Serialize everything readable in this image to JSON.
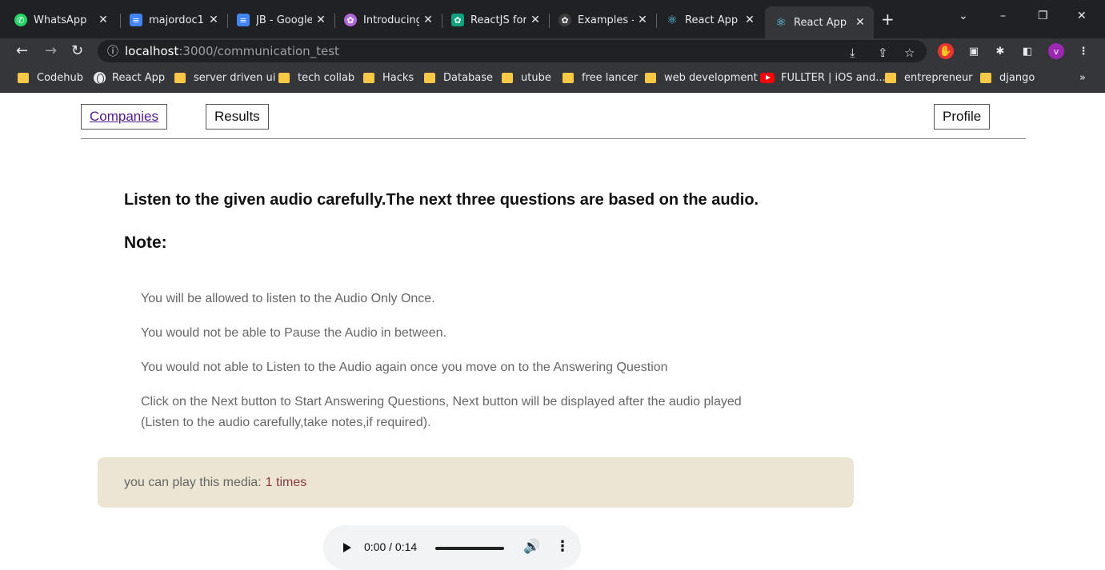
{
  "browser": {
    "tabs": [
      {
        "title": "WhatsApp",
        "icon": "whatsapp-icon",
        "color": "#25d366"
      },
      {
        "title": "majordoc1 -",
        "icon": "google-docs-icon",
        "color": "#4285f4"
      },
      {
        "title": "JB - Google",
        "icon": "google-docs-icon",
        "color": "#4285f4"
      },
      {
        "title": "Introducing",
        "icon": "openai-icon",
        "color": "#b368d9"
      },
      {
        "title": "ReactJS for",
        "icon": "chatgpt-icon",
        "color": "#10a37f"
      },
      {
        "title": "Examples -",
        "icon": "openai-icon",
        "color": "#3c3c3c"
      },
      {
        "title": "React App",
        "icon": "react-icon",
        "color": "#61dafb"
      },
      {
        "title": "React App",
        "icon": "react-icon",
        "color": "#61dafb",
        "active": true
      }
    ],
    "address": {
      "host": "localhost",
      "path": ":3000/communication_test"
    },
    "bookmarks": [
      {
        "label": "Codehub",
        "icon": "folder-icon"
      },
      {
        "label": "React App",
        "icon": "globe-icon"
      },
      {
        "label": "server driven ui",
        "icon": "folder-icon"
      },
      {
        "label": "tech collab",
        "icon": "folder-icon"
      },
      {
        "label": "Hacks",
        "icon": "folder-icon"
      },
      {
        "label": "Database",
        "icon": "folder-icon"
      },
      {
        "label": "utube",
        "icon": "folder-icon"
      },
      {
        "label": "free lancer",
        "icon": "folder-icon"
      },
      {
        "label": "web development",
        "icon": "folder-icon"
      },
      {
        "label": "FULLTER | iOS and...",
        "icon": "youtube-icon"
      },
      {
        "label": "entrepreneur",
        "icon": "folder-icon"
      },
      {
        "label": "django",
        "icon": "folder-icon"
      }
    ],
    "profile_initial": "v"
  },
  "nav": {
    "companies": "Companies",
    "results": "Results",
    "profile": "Profile"
  },
  "content": {
    "heading": "Listen to the given audio carefully.The next three questions are based on the audio.",
    "note_label": "Note:",
    "rules": [
      "You will be allowed to listen to the Audio Only Once.",
      "You would not be able to Pause the Audio in between.",
      "You would not able to Listen to the Audio again once you move on to the Answering Question",
      "Click on the Next button to Start Answering Questions, Next button will be displayed after the audio played",
      "(Listen to the audio carefully,take notes,if required)."
    ],
    "media_label": "you can play this media:",
    "media_count": "1 times"
  },
  "audio_player": {
    "time": "0:00 / 0:14",
    "progress": 0
  },
  "colors": {
    "media_box_bg": "#ece5d3",
    "media_count": "#8a3a3a",
    "link": "#551a8b"
  }
}
